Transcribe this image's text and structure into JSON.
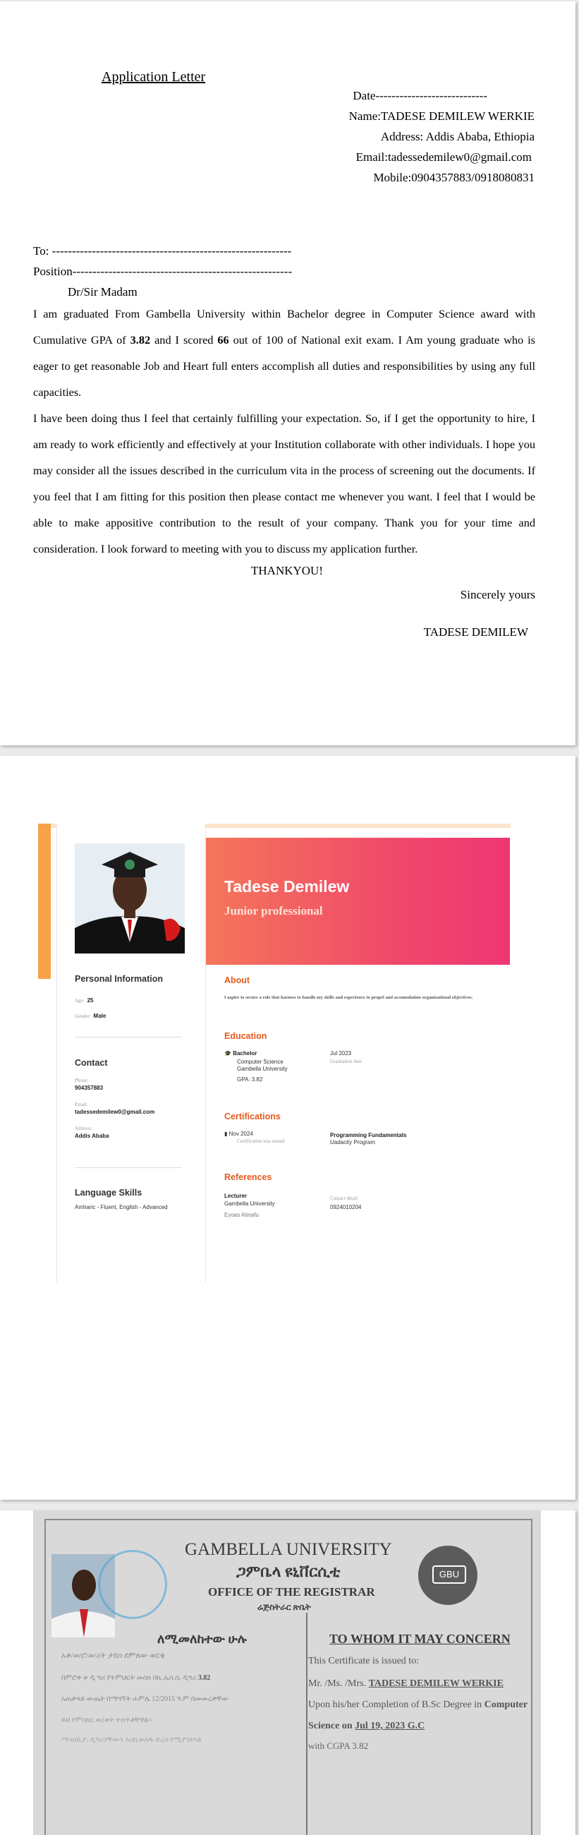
{
  "letter": {
    "title": "Application Letter",
    "date_line": "Date----------------------------",
    "name_line": "Name:TADESE DEMILEW WERKIE",
    "address_line": "Address: Addis Ababa, Ethiopia",
    "email_line": "Email:tadessedemilew0@gmail.com",
    "mobile_line": "Mobile:0904357883/0918080831",
    "to_line": "To: ------------------------------------------------------------",
    "position_line": "Position-------------------------------------------------------",
    "salutation": "Dr/Sir Madam",
    "p1_a": "I am graduated From Gambella University within Bachelor degree in Computer  Science award with Cumulative GPA of ",
    "gpa": "3.82",
    "p1_b": " and I scored ",
    "score": "66",
    "p1_c": " out of 100 of National exit exam. I Am young graduate who is eager to get reasonable Job and Heart full enters accomplish all duties and responsibilities by using any full capacities.",
    "p2": "I have been doing thus I feel that certainly fulfilling your expectation. So, if I get the opportunity to hire, I am ready to work efficiently and effectively at your Institution collaborate with other individuals. I hope you may consider all the issues described in the curriculum vita in the process of screening out the documents. If you feel that I am fitting for this position then please contact me whenever you want. I feel that I would be able to make appositive contribution to the result of your company. Thank you for your time and consideration. I look forward to meeting with you to discuss my application further.",
    "thanks": "THANKYOU!",
    "closing": "Sincerely yours",
    "signature": "TADESE DEMILEW"
  },
  "cv": {
    "name": "Tadese Demilew",
    "role": "Junior professional",
    "personal_title": "Personal Information",
    "age_label": "Age:",
    "age": "25",
    "gender_label": "Gender:",
    "gender": "Male",
    "contact_title": "Contact",
    "phone_label": "Phone:",
    "phone": "904357883",
    "email_label": "Email:",
    "email": "tadessedemilew0@gmail.com",
    "address_label": "Address:",
    "address": "Addis Ababa",
    "lang_title": "Language Skills",
    "languages": "Amharic - Fluent, English - Advanced",
    "about_title": "About",
    "about": "I aspire to secure a role that harness to handle my skills and experience to propel and accumulation organizational objectives.",
    "edu_title": "Education",
    "edu_degree": "Bachelor",
    "edu_field": "Computer Science",
    "edu_school": "Gambella University",
    "edu_gpa": "GPA:  3.82",
    "edu_date": "Jul 2023",
    "edu_date_label": "Graduation date",
    "cert_title": "Certifications",
    "cert_date": "Nov 2024",
    "cert_date_label": "Certification was issued",
    "cert_name": "Programming Fundamentals",
    "cert_org": "Uadacity Program",
    "ref_title": "References",
    "ref_role": "Lecturer",
    "ref_org": "Gambella University",
    "ref_name": "Eyoas Atinafu",
    "ref_contact_label": "Contact detail",
    "ref_contact": "0924010204"
  },
  "certificate": {
    "university": "GAMBELLA UNIVERSITY",
    "university_amharic": "ጋምቤላ ዩኒቨርሲቲ",
    "office": "OFFICE OF THE REGISTRAR",
    "office_amharic": "ሬጅስትራር ጽቤት",
    "badge": "GBU",
    "heading_amharic": "ለሚመለከተው ሁሉ",
    "heading": "TO WHOM IT MAY CONCERN",
    "issued_to": "This Certificate is issued to:",
    "mr": "Mr. /Ms. /Mrs.",
    "holder": "TADESE DEMILEW WERKIE",
    "completion": "Upon his/her Completion of B.Sc Degree in",
    "field": "Computer",
    "science_on": "Science on",
    "date": "Jul 19, 2023 G.C",
    "cgpa": "with CGPA 3.82",
    "am_line1": "አቶ/ወ/ሮ/ወ/ሪት  ታደሰ ደምለው ወርቄ",
    "am_line2": "በምሮቀ ቱ ዲ ግሪ    የትምህርት መስክ በኪ.ኤስ.ሲ ዲግሪ",
    "am_gpa": "3.82",
    "am_line3": "አጠቃላይ ውጤት በማግኘት   ሐምሌ 12/2015 ዓ.ም  በመመረቃቸው",
    "am_line4": "ይህ የምስክር ወረቀት ተሰጥቶቸዋል፡፡",
    "am_line5": "ማሳሰቢያ: ዲግሪያቸውን እስኪወስዱ ድረስ የሚያገለግል"
  }
}
